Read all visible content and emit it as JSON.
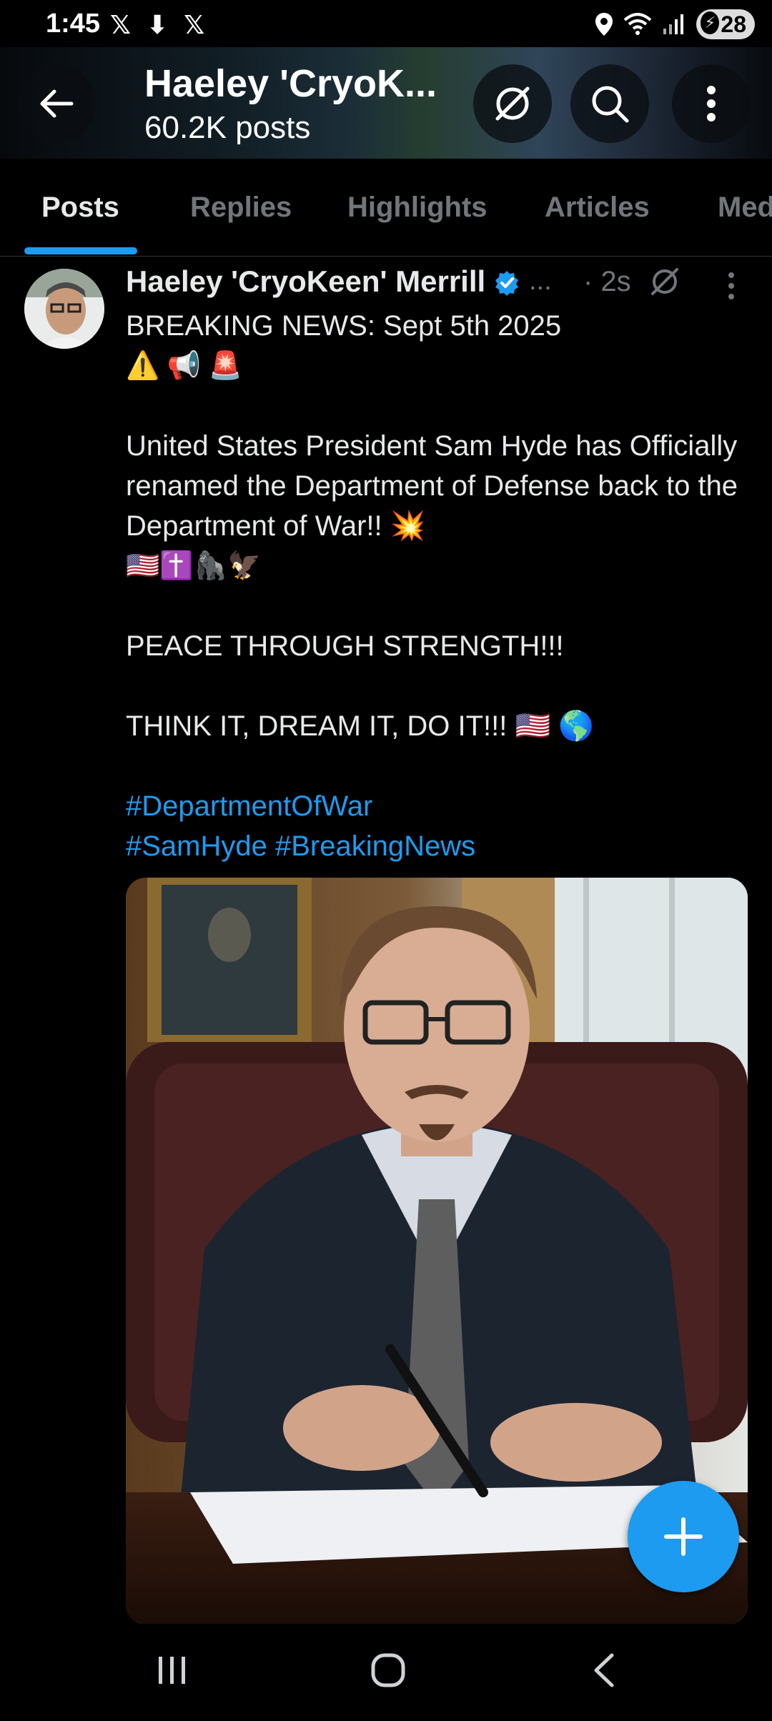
{
  "status_bar": {
    "time": "1:45",
    "left_icons": "𝕏 ⬇ 𝕏",
    "battery": "28"
  },
  "header": {
    "title": "Haeley 'CryoK...",
    "subtitle": "60.2K posts"
  },
  "tabs": [
    {
      "label": "Posts",
      "active": true
    },
    {
      "label": "Replies",
      "active": false
    },
    {
      "label": "Highlights",
      "active": false
    },
    {
      "label": "Articles",
      "active": false
    },
    {
      "label": "Med",
      "active": false
    }
  ],
  "post": {
    "author": "Haeley 'CryoKeen' Merrill",
    "handle_truncated": "...",
    "time": "· 2s",
    "line1": "BREAKING NEWS: Sept 5th 2025",
    "emoji1": "⚠️ 📢 🚨",
    "para1": "United States President Sam Hyde has Officially renamed the Department of Defense back to the Department of War!! 💥",
    "emoji2": "🇺🇸✝️🦍🦅",
    "para2": "PEACE THROUGH STRENGTH!!!",
    "para3": "THINK IT, DREAM IT, DO IT!!! 🇺🇸 🌎",
    "hashtag1": "#DepartmentOfWar",
    "hashtag2": "#SamHyde",
    "hashtag3": "#BreakingNews"
  },
  "colors": {
    "accent": "#1d9bf0",
    "muted": "#71767b",
    "background": "#000000"
  }
}
